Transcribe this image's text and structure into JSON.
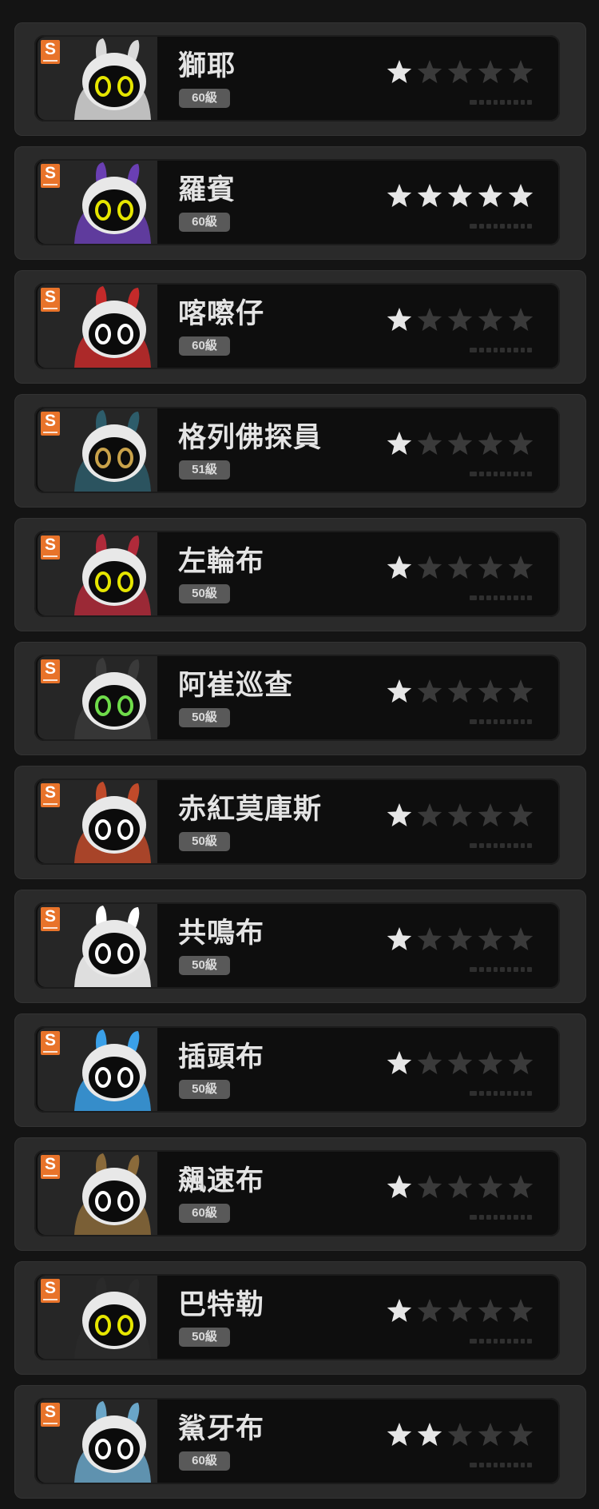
{
  "agents": [
    {
      "name": "獅耶",
      "level": "60級",
      "rank": "S",
      "stars": 1,
      "accent": "#d9d9d9",
      "eyes": "#e6e600"
    },
    {
      "name": "羅賓",
      "level": "60級",
      "rank": "S",
      "stars": 5,
      "accent": "#6a3fb3",
      "eyes": "#e6e600"
    },
    {
      "name": "喀嚓仔",
      "level": "60級",
      "rank": "S",
      "stars": 1,
      "accent": "#c42a2a",
      "eyes": "#ffffff"
    },
    {
      "name": "格列佛探員",
      "level": "51級",
      "rank": "S",
      "stars": 1,
      "accent": "#2d5c6a",
      "eyes": "#c9a24a"
    },
    {
      "name": "左輪布",
      "level": "50級",
      "rank": "S",
      "stars": 1,
      "accent": "#b02a3a",
      "eyes": "#e6e600"
    },
    {
      "name": "阿崔巡查",
      "level": "50級",
      "rank": "S",
      "stars": 1,
      "accent": "#3a3a3a",
      "eyes": "#6fdc4a"
    },
    {
      "name": "赤紅莫庫斯",
      "level": "50級",
      "rank": "S",
      "stars": 1,
      "accent": "#c04a2a",
      "eyes": "#ffffff"
    },
    {
      "name": "共鳴布",
      "level": "50級",
      "rank": "S",
      "stars": 1,
      "accent": "#ffffff",
      "eyes": "#ffffff"
    },
    {
      "name": "插頭布",
      "level": "50級",
      "rank": "S",
      "stars": 1,
      "accent": "#3aa0e8",
      "eyes": "#ffffff"
    },
    {
      "name": "飆速布",
      "level": "60級",
      "rank": "S",
      "stars": 1,
      "accent": "#8a6a3a",
      "eyes": "#ffffff"
    },
    {
      "name": "巴特勒",
      "level": "50級",
      "rank": "S",
      "stars": 1,
      "accent": "#2a2a2a",
      "eyes": "#e6e600"
    },
    {
      "name": "鯊牙布",
      "level": "60級",
      "rank": "S",
      "stars": 2,
      "accent": "#6aa6c8",
      "eyes": "#ffffff"
    }
  ],
  "max_stars": 5,
  "colors": {
    "star_filled": "#e6e6e6",
    "star_empty": "#3a3a3a",
    "rank_badge": "#e8732a"
  }
}
